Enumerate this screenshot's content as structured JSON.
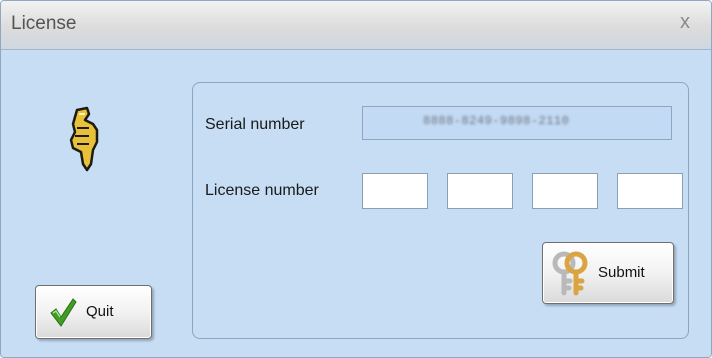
{
  "window": {
    "title": "License",
    "close_glyph": "x"
  },
  "icons": {
    "hand": "pointing-hand-icon",
    "quit": "checkmark-icon",
    "submit": "keys-icon"
  },
  "form": {
    "serial_label": "Serial number",
    "serial_value": "8888-8249-9898-2110",
    "license_label": "License number",
    "license_fields": [
      "",
      "",
      "",
      ""
    ]
  },
  "buttons": {
    "quit_label": "Quit",
    "submit_label": "Submit"
  },
  "colors": {
    "background": "#c6ddf4",
    "checkmark": "#3f9e24",
    "keys": "#d9a441"
  }
}
